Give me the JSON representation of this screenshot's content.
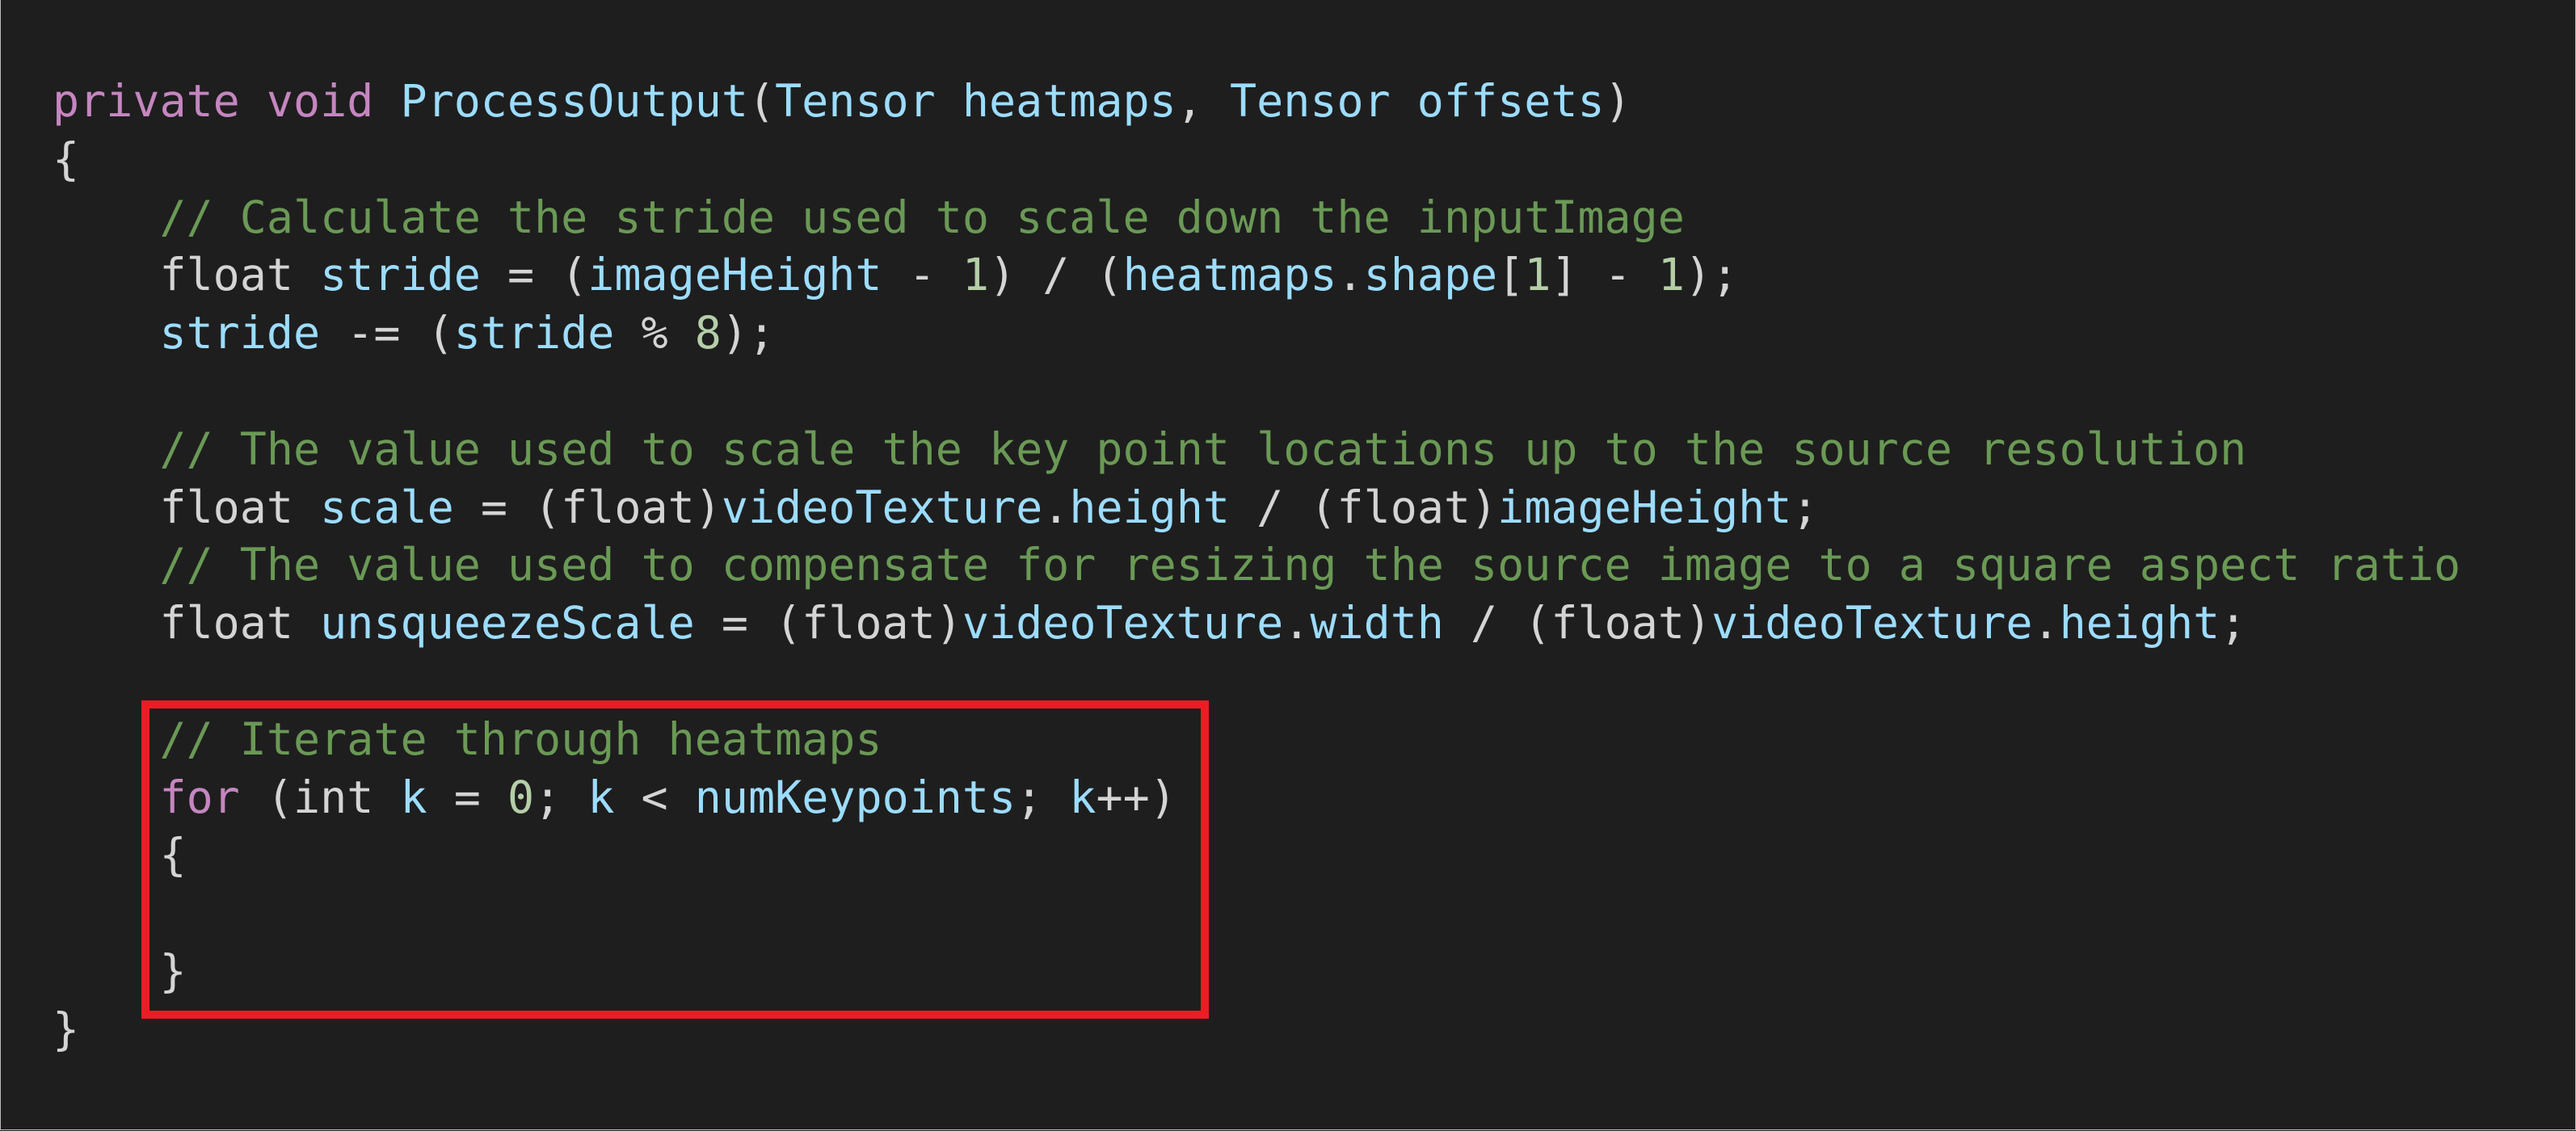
{
  "colors": {
    "background": "#1e1e1e",
    "keyword": "#c586c0",
    "identifier": "#9cdcfe",
    "comment": "#6a9955",
    "number": "#b5cea8",
    "text": "#d4d4d4",
    "highlight_box": "#ed1c24"
  },
  "code": {
    "lines": [
      [
        [
          "kw",
          "private void "
        ],
        [
          "id",
          "ProcessOutput"
        ],
        [
          "txt",
          "("
        ],
        [
          "id",
          "Tensor heatmaps"
        ],
        [
          "txt",
          ", "
        ],
        [
          "id",
          "Tensor offsets"
        ],
        [
          "txt",
          ")"
        ]
      ],
      [
        [
          "txt",
          "{"
        ]
      ],
      [
        [
          "txt",
          "    "
        ],
        [
          "cm",
          "// Calculate the stride used to scale down the inputImage"
        ]
      ],
      [
        [
          "txt",
          "    float "
        ],
        [
          "id",
          "stride"
        ],
        [
          "txt",
          " = ("
        ],
        [
          "id",
          "imageHeight"
        ],
        [
          "txt",
          " - "
        ],
        [
          "num",
          "1"
        ],
        [
          "txt",
          ") / ("
        ],
        [
          "id",
          "heatmaps"
        ],
        [
          "txt",
          "."
        ],
        [
          "id",
          "shape"
        ],
        [
          "txt",
          "["
        ],
        [
          "num",
          "1"
        ],
        [
          "txt",
          "] - "
        ],
        [
          "num",
          "1"
        ],
        [
          "txt",
          ");"
        ]
      ],
      [
        [
          "txt",
          "    "
        ],
        [
          "id",
          "stride"
        ],
        [
          "txt",
          " -= ("
        ],
        [
          "id",
          "stride"
        ],
        [
          "txt",
          " % "
        ],
        [
          "num",
          "8"
        ],
        [
          "txt",
          ");"
        ]
      ],
      [],
      [
        [
          "txt",
          "    "
        ],
        [
          "cm",
          "// The value used to scale the key point locations up to the source resolution"
        ]
      ],
      [
        [
          "txt",
          "    float "
        ],
        [
          "id",
          "scale"
        ],
        [
          "txt",
          " = (float)"
        ],
        [
          "id",
          "videoTexture"
        ],
        [
          "txt",
          "."
        ],
        [
          "id",
          "height"
        ],
        [
          "txt",
          " / (float)"
        ],
        [
          "id",
          "imageHeight"
        ],
        [
          "txt",
          ";"
        ]
      ],
      [
        [
          "txt",
          "    "
        ],
        [
          "cm",
          "// The value used to compensate for resizing the source image to a square aspect ratio"
        ]
      ],
      [
        [
          "txt",
          "    float "
        ],
        [
          "id",
          "unsqueezeScale"
        ],
        [
          "txt",
          " = (float)"
        ],
        [
          "id",
          "videoTexture"
        ],
        [
          "txt",
          "."
        ],
        [
          "id",
          "width"
        ],
        [
          "txt",
          " / (float)"
        ],
        [
          "id",
          "videoTexture"
        ],
        [
          "txt",
          "."
        ],
        [
          "id",
          "height"
        ],
        [
          "txt",
          ";"
        ]
      ],
      [],
      [
        [
          "txt",
          "    "
        ],
        [
          "cm",
          "// Iterate through heatmaps"
        ]
      ],
      [
        [
          "txt",
          "    "
        ],
        [
          "kw",
          "for"
        ],
        [
          "txt",
          " (int "
        ],
        [
          "id",
          "k"
        ],
        [
          "txt",
          " = "
        ],
        [
          "num",
          "0"
        ],
        [
          "txt",
          "; "
        ],
        [
          "id",
          "k"
        ],
        [
          "txt",
          " < "
        ],
        [
          "id",
          "numKeypoints"
        ],
        [
          "txt",
          "; "
        ],
        [
          "id",
          "k"
        ],
        [
          "txt",
          "++)"
        ]
      ],
      [
        [
          "txt",
          "    {"
        ]
      ],
      [],
      [
        [
          "txt",
          "    }"
        ]
      ],
      [
        [
          "txt",
          "}"
        ]
      ]
    ]
  }
}
